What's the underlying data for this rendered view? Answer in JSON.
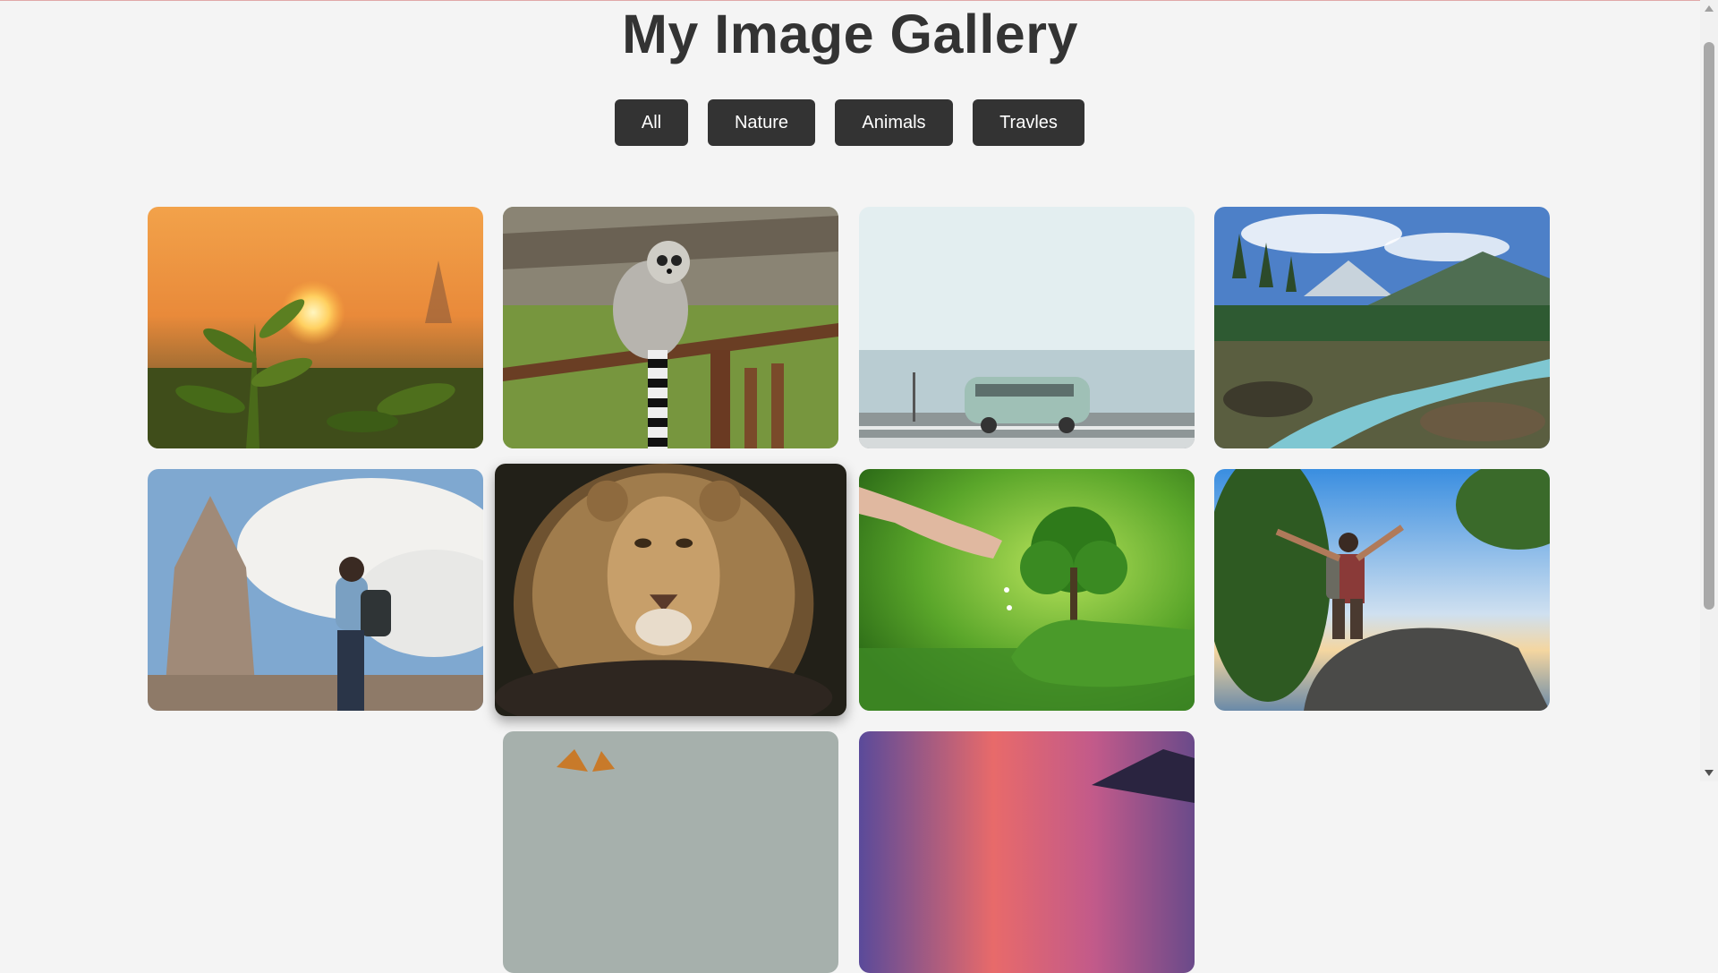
{
  "header": {
    "title": "My Image Gallery"
  },
  "filters": [
    {
      "label": "All"
    },
    {
      "label": "Nature"
    },
    {
      "label": "Animals"
    },
    {
      "label": "Travles"
    }
  ],
  "gallery": {
    "items": [
      {
        "category": "nature",
        "icon": "sunset-tea-plant-image"
      },
      {
        "category": "animals",
        "icon": "lemur-image"
      },
      {
        "category": "travel",
        "icon": "van-by-sea-image"
      },
      {
        "category": "nature",
        "icon": "mountain-river-image"
      },
      {
        "category": "travel",
        "icon": "temple-traveler-image"
      },
      {
        "category": "animals",
        "icon": "lion-image"
      },
      {
        "category": "nature",
        "icon": "tree-in-hand-image"
      },
      {
        "category": "travel",
        "icon": "hiker-on-rock-image"
      },
      {
        "category": "animals",
        "icon": "fox-image"
      },
      {
        "category": "nature",
        "icon": "sunset-mountains-image"
      }
    ]
  },
  "colors": {
    "background": "#f4f4f4",
    "button": "#333333",
    "button_text": "#ffffff",
    "title": "#333333"
  }
}
